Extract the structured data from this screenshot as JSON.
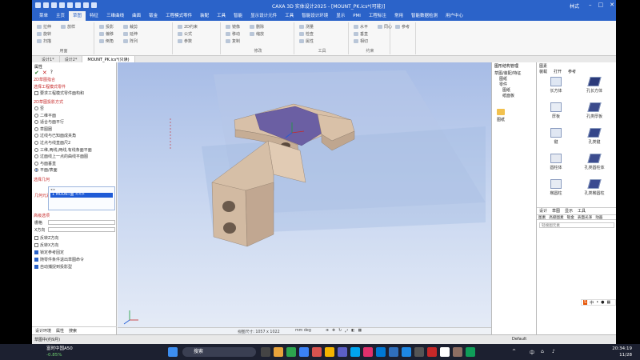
{
  "app": {
    "title": "CAXA 3D 实体设计2025 - [MOUNT_PK.ics*(可能)]",
    "user": "林式"
  },
  "menu": [
    "菜单",
    "主页",
    "草图",
    "特征",
    "三维曲线",
    "曲面",
    "钣金",
    "工程模式零件",
    "装配",
    "工具",
    "智能",
    "显示设计元件",
    "工具",
    "智能设计环境",
    "显示",
    "PMI",
    "工程标注",
    "常用",
    "智能数据检测",
    "用户中心"
  ],
  "menu_active_index": 2,
  "ribbon": {
    "groups": [
      {
        "label": "用面",
        "buttons": [
          "拉伸",
          "旋转",
          "扫描",
          "放样"
        ]
      },
      {
        "label": "",
        "buttons": [
          "投影",
          "偏移",
          "倒角",
          "裁剪",
          "延伸",
          "阵列"
        ]
      },
      {
        "label": "",
        "buttons": [
          "2D约束",
          "公式",
          "参数"
        ]
      },
      {
        "label": "修改",
        "buttons": [
          "镜像",
          "移动",
          "复制",
          "删除",
          "缩放"
        ]
      },
      {
        "label": "工具",
        "buttons": [
          "测量",
          "检查",
          "属性"
        ]
      },
      {
        "label": "约束",
        "buttons": [
          "水平",
          "垂直",
          "相切",
          "同心"
        ]
      },
      {
        "label": "",
        "buttons": [
          "参考"
        ]
      }
    ]
  },
  "doc_tabs": [
    "设计1*",
    "设计2*",
    "MOUNT_PK.ics*(只读)"
  ],
  "doc_tab_active": 2,
  "left_panel": {
    "title": "属性",
    "sec1": "2D草图指合",
    "sec2": "选择工程模式零件",
    "item_keep": "要求工程模式零件面构和",
    "sec3": "2D草图投影方式",
    "options": [
      "否",
      "二维平面",
      "适合与面平行",
      "草图圈",
      "过线与已知面成夹角",
      "过点与线直面尺2",
      "三维,两线,两线,有线条面平面",
      "过面线上一点的曲线平面图",
      "与面垂直",
      "平面/表面"
    ],
    "option_selected": 9,
    "sec4": "选择几何",
    "selection_label": "几何元素",
    "selection_value": "1 MOUNT面 <<>",
    "sec5": "高级选项",
    "field1_label": "栅格",
    "field2_label": "X方向",
    "checks": [
      {
        "label": "反转Z方向",
        "on": false
      },
      {
        "label": "反转X方向",
        "on": false
      },
      {
        "label": "锁定参考固定",
        "on": true
      },
      {
        "label": "随零件条件退出草图命令",
        "on": true
      },
      {
        "label": "自动捕捉到投影型",
        "on": true
      }
    ],
    "bottom_tabs": [
      "设计环境",
      "属性",
      "搜索"
    ]
  },
  "viewport": {
    "status_text": "视图尺寸: 1057 x 1022",
    "units": "mm  deg"
  },
  "tree_panel": {
    "title": "图形结构管理",
    "rows": [
      "草图/装配/特征",
      "图纸",
      "零件",
      "图纸",
      "纸面板"
    ],
    "folder_label": "图纸"
  },
  "catalog": {
    "title": "图素",
    "tools": [
      "装载",
      "打开",
      "参考"
    ],
    "items": [
      "长方体",
      "孔长方体",
      "厚板",
      "孔类厚板",
      "键",
      "孔类键",
      "圆柱体",
      "孔类圆柱体",
      "椭圆柱",
      "孔类椭圆柱"
    ],
    "tabs_mid": [
      "设计",
      "草图",
      "显示",
      "工具"
    ],
    "tabs2": [
      "图素",
      "高级图素",
      "钣金",
      "表面光泽",
      "动画"
    ],
    "search_placeholder": "轻搜图元素"
  },
  "app_status": {
    "left": "草图中(约9月)",
    "right": "Default"
  },
  "taskbar": {
    "weather_line1": "富时中国A50",
    "weather_line2": "-0.85%",
    "search_label": "搜索",
    "time": "20:34:19",
    "date": "11/28",
    "ime": "中"
  },
  "colors": {
    "accent": "#2b63c9",
    "part_face": "#d9bfa6",
    "selected_face": "#6b5fa3",
    "viewport_top": "#a7bce6"
  }
}
